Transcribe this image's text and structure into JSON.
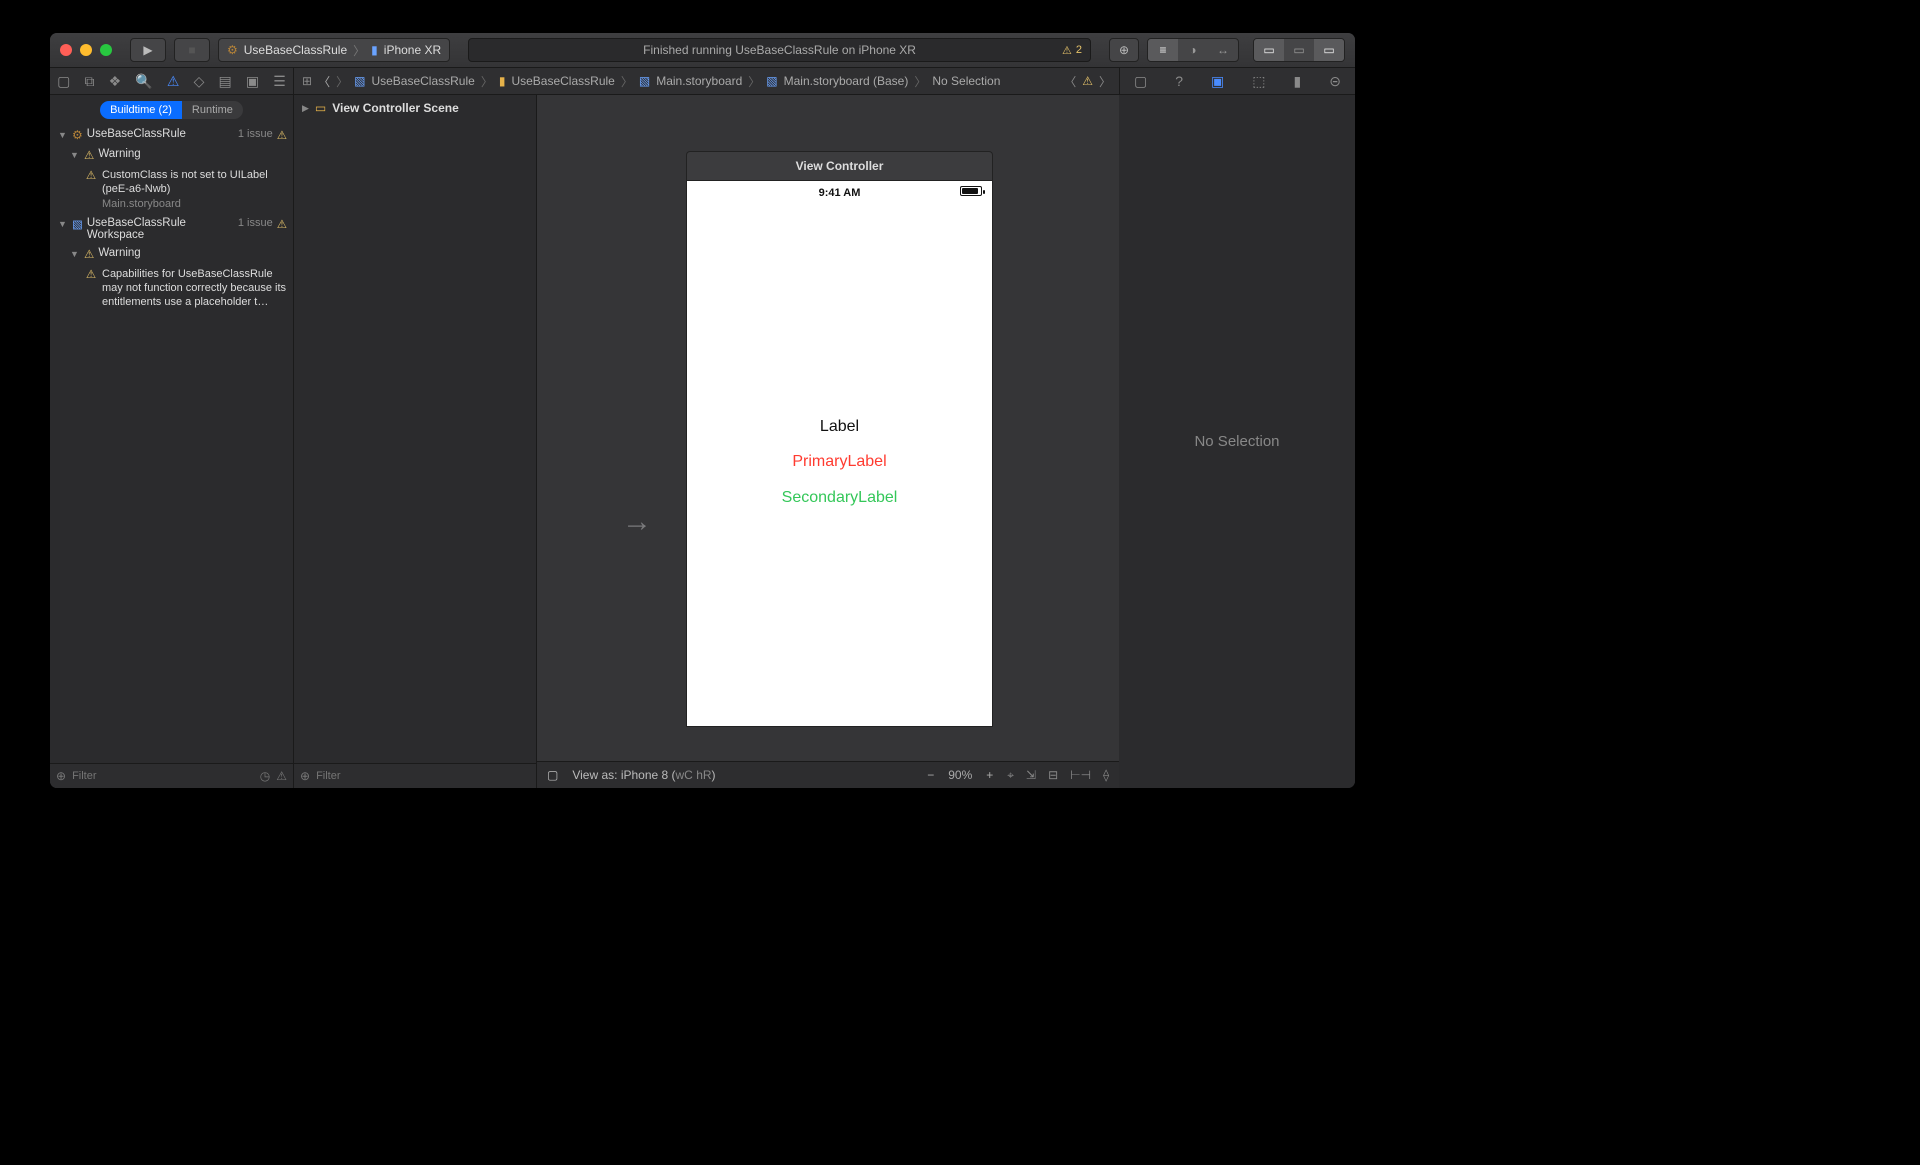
{
  "toolbar": {
    "scheme_target": "UseBaseClassRule",
    "scheme_device": "iPhone XR",
    "status_text": "Finished running UseBaseClassRule on iPhone XR",
    "status_warn_count": "2"
  },
  "navigator_tabs": {
    "buildtime": "Buildtime (2)",
    "runtime": "Runtime"
  },
  "issues": {
    "project": {
      "name": "UseBaseClassRule",
      "count": "1 issue"
    },
    "project_warning_heading": "Warning",
    "project_warning_text": "CustomClass is not set to UILabel (peE-a6-Nwb)",
    "project_warning_file": "Main.storyboard",
    "workspace": {
      "name": "UseBaseClassRule Workspace",
      "count": "1 issue"
    },
    "workspace_warning_heading": "Warning",
    "workspace_warning_text": "Capabilities for UseBaseClassRule may not function correctly because its entitlements use a placeholder t…"
  },
  "filter_placeholder": "Filter",
  "outline": {
    "scene": "View Controller Scene"
  },
  "breadcrumb": {
    "p1": "UseBaseClassRule",
    "p2": "UseBaseClassRule",
    "p3": "Main.storyboard",
    "p4": "Main.storyboard (Base)",
    "p5": "No Selection"
  },
  "canvas": {
    "vc_title": "View Controller",
    "clock": "9:41 AM",
    "label1": "Label",
    "label2": "PrimaryLabel",
    "label3": "SecondaryLabel"
  },
  "canvas_footer": {
    "view_as": "View as: iPhone 8 (",
    "size_class_w": "wC",
    "size_class_h": "hR",
    "close": ")",
    "zoom": "90%"
  },
  "inspector": {
    "empty": "No Selection"
  }
}
